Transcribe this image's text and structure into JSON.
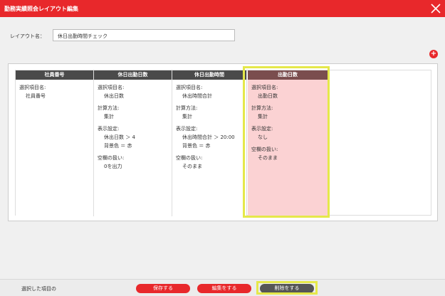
{
  "window": {
    "title": "勤務実績照会レイアウト編集"
  },
  "layout": {
    "label": "レイアウト名：",
    "name_value": "休日出勤時間チェック"
  },
  "add_button": {
    "glyph": "+"
  },
  "columns": [
    {
      "header": "社員番号",
      "fields": [
        {
          "key": "選択項目名:",
          "value": "社員番号"
        }
      ]
    },
    {
      "header": "休日出勤日数",
      "fields": [
        {
          "key": "選択項目名:",
          "value": "休出日数"
        },
        {
          "key": "計算方法:",
          "value": "集計"
        },
        {
          "key": "表示設定:",
          "value": "休出日数 ＞ 4",
          "value2": "背景色 ＝ 赤"
        },
        {
          "key": "空欄の扱い:",
          "value": "0を出力"
        }
      ]
    },
    {
      "header": "休日出勤時間",
      "fields": [
        {
          "key": "選択項目名:",
          "value": "休出時間合計"
        },
        {
          "key": "計算方法:",
          "value": "集計"
        },
        {
          "key": "表示設定:",
          "value": "休出時間合計 ＞ 20:00",
          "value2": "背景色 ＝ 赤"
        },
        {
          "key": "空欄の扱い:",
          "value": "そのまま"
        }
      ]
    },
    {
      "header": "出勤日数",
      "fields": [
        {
          "key": "選択項目名:",
          "value": "出勤日数"
        },
        {
          "key": "計算方法:",
          "value": "集計"
        },
        {
          "key": "表示設定:",
          "value": "なし"
        },
        {
          "key": "空欄の扱い:",
          "value": "そのまま"
        }
      ]
    }
  ],
  "footer": {
    "message": "選択した項目の",
    "save_label": "保存する",
    "edit_label": "編集をする",
    "delete_label": "削除をする"
  },
  "colors": {
    "accent": "#e8282b",
    "header_dark": "#4a4a4a",
    "selected_fill": "#fbd2d3",
    "highlight": "#e5e84a"
  }
}
